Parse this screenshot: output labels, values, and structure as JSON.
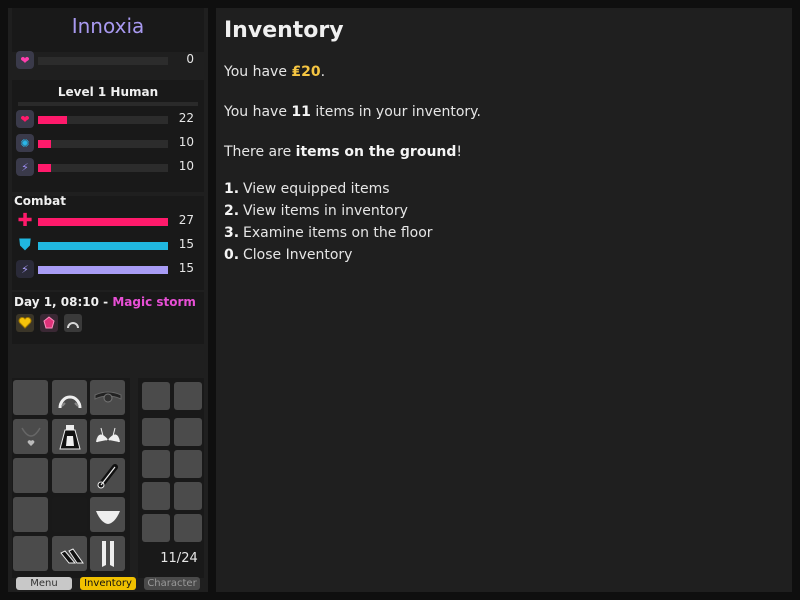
{
  "player": {
    "name": "Innoxia",
    "arousal_value": "0",
    "arousal_fill": 0.0,
    "level_title": "Level 1 Human"
  },
  "attributes": [
    {
      "icon": "heart-icon",
      "glyph": "❤",
      "value": "22",
      "fill": 0.22,
      "color": "#ff1a6b"
    },
    {
      "icon": "brain-icon",
      "glyph": "✺",
      "value": "10",
      "fill": 0.1,
      "color": "#ff1a6b",
      "icon_color": "#2ab7e8"
    },
    {
      "icon": "lightning-icon",
      "glyph": "⚡",
      "value": "10",
      "fill": 0.1,
      "color": "#ff1a6b",
      "icon_color": "#9b8cf0"
    }
  ],
  "combat": {
    "title": "Combat",
    "rows": [
      {
        "icon": "health-cross-icon",
        "glyph": "✚",
        "value": "27",
        "fill": 1.0,
        "color": "#ff1a6b"
      },
      {
        "icon": "shield-icon",
        "glyph": "⛊",
        "value": "15",
        "fill": 1.0,
        "color": "#20b7e0"
      },
      {
        "icon": "aura-icon",
        "glyph": "⚡",
        "value": "15",
        "fill": 1.0,
        "color": "#a89cf5"
      }
    ]
  },
  "time": {
    "label": "Day 1, 08:10",
    "separator": " - ",
    "weather": "Magic storm"
  },
  "effects": [
    "gold-heart-icon",
    "pink-crystal-icon",
    "headband-icon"
  ],
  "inventory_count": "11/24",
  "tabs": {
    "menu": "Menu",
    "inventory": "Inventory",
    "character": "Character"
  },
  "main": {
    "title": "Inventory",
    "money_prefix": "You have ",
    "money": "₤20",
    "money_suffix": ".",
    "items_prefix": "You have ",
    "items_count": "11",
    "items_suffix": " items in your inventory.",
    "ground_prefix": "There are ",
    "ground_bold": "items on the ground",
    "ground_suffix": "!",
    "options": [
      {
        "key": "1.",
        "label": "View equipped items"
      },
      {
        "key": "2.",
        "label": "View items in inventory"
      },
      {
        "key": "3.",
        "label": "Examine items on the floor"
      },
      {
        "key": "0.",
        "label": "Close Inventory"
      }
    ]
  },
  "colors": {
    "accent_name": "#a899f0",
    "weather": "#e84fd6",
    "money": "#f5c542",
    "active_tab": "#f0c000"
  }
}
